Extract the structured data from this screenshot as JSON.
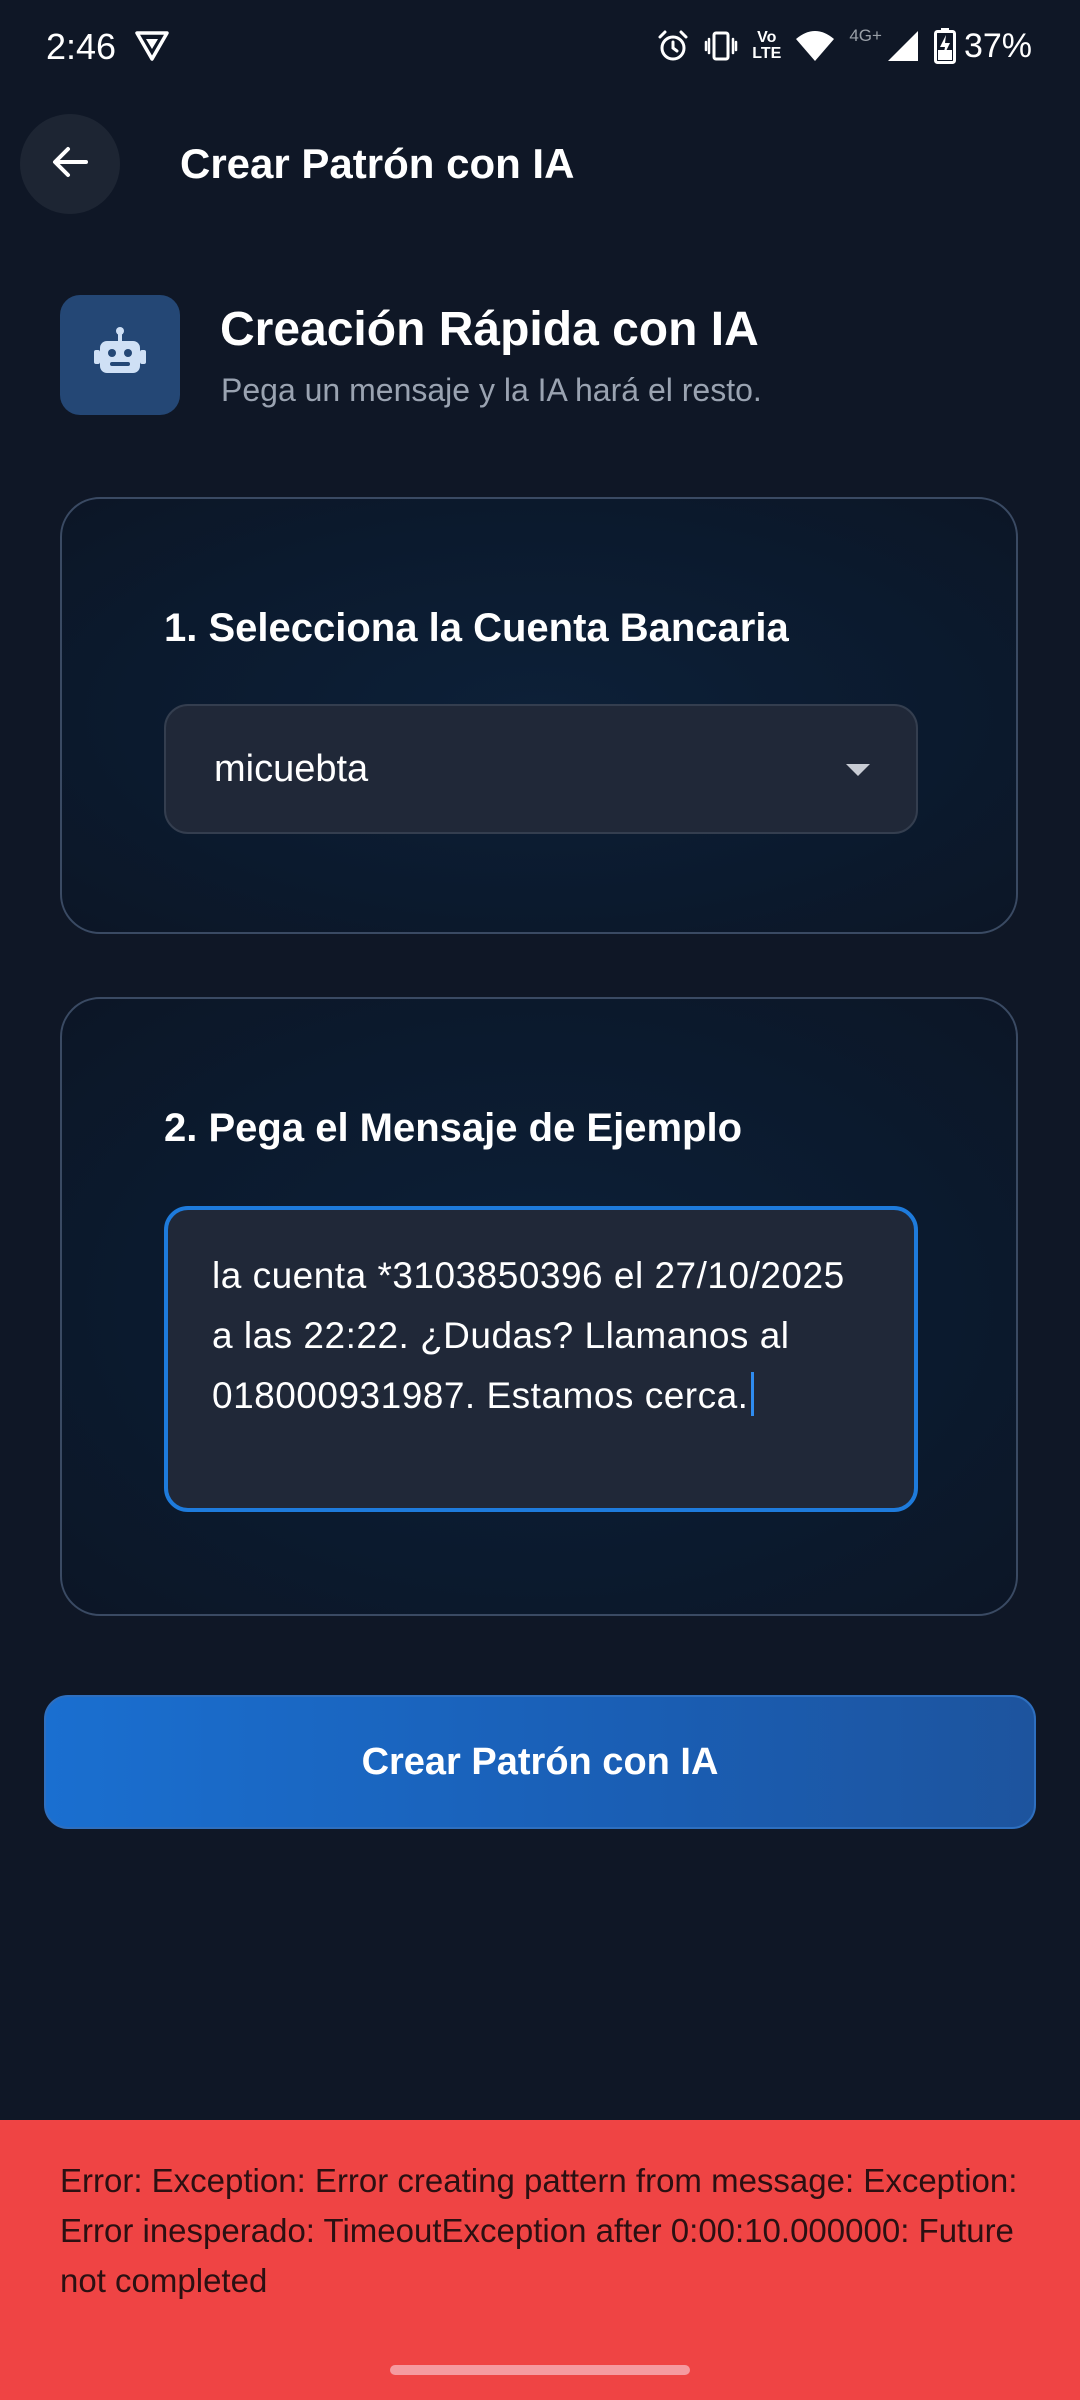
{
  "status_bar": {
    "time": "2:46",
    "volte_top": "Vo",
    "volte_bottom": "LTE",
    "network": "4G+",
    "battery_percent": "37%",
    "icons": [
      "vpn-icon",
      "alarm-icon",
      "vibrate-icon",
      "volte-icon",
      "wifi-icon",
      "signal-icon",
      "battery-charging-icon"
    ]
  },
  "app_bar": {
    "back_icon": "arrow-left-icon",
    "title": "Crear Patrón con IA"
  },
  "header": {
    "icon": "robot-icon",
    "title": "Creación Rápida con IA",
    "subtitle": "Pega un mensaje y la IA hará el resto."
  },
  "account_card": {
    "label": "1. Selecciona la Cuenta Bancaria",
    "selected_account": "micuebta",
    "caret_icon": "dropdown-caret-icon"
  },
  "message_card": {
    "label": "2. Pega el Mensaje de Ejemplo",
    "message_value": "la cuenta *3103850396 el 27/10/2025 a las 22:22. ¿Dudas? Llamanos al 018000931987. Estamos cerca."
  },
  "primary_action": {
    "label": "Crear Patrón con IA"
  },
  "snackbar": {
    "message": "Error: Exception: Error creating pattern from message: Exception: Error inesperado: TimeoutException after 0:00:10.000000: Future not completed"
  },
  "colors": {
    "background": "#0f1726",
    "accent": "#1e7bdc",
    "error": "#ef4444",
    "icon_tile": "#244775"
  }
}
